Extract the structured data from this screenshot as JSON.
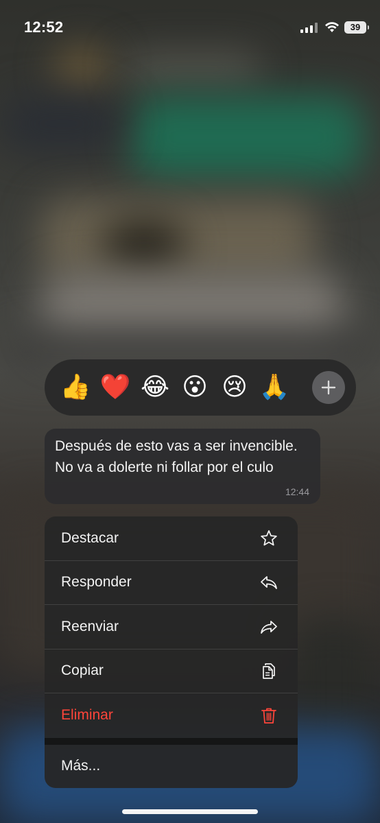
{
  "status_bar": {
    "time": "12:52",
    "battery": "39"
  },
  "reactions": {
    "emojis": [
      "👍",
      "❤️",
      "😂",
      "😮",
      "😢",
      "🙏"
    ],
    "icons": [
      "thumbs-up-icon",
      "heart-icon",
      "tears-of-joy-icon",
      "surprised-icon",
      "crying-icon",
      "pray-icon"
    ],
    "more_icon": "plus-icon"
  },
  "message": {
    "text": "Después de esto vas a ser invencible. No va a dolerte ni follar por el culo",
    "time": "12:44"
  },
  "menu": {
    "items": [
      {
        "label": "Destacar",
        "icon": "star-icon"
      },
      {
        "label": "Responder",
        "icon": "reply-icon"
      },
      {
        "label": "Reenviar",
        "icon": "forward-icon"
      },
      {
        "label": "Copiar",
        "icon": "copy-icon"
      },
      {
        "label": "Eliminar",
        "icon": "trash-icon",
        "color": "#ff453a"
      }
    ],
    "more_label": "Más..."
  },
  "colors": {
    "danger": "#ff453a",
    "menu_background": "#262626",
    "bubble_background": "#2c2c2e"
  }
}
